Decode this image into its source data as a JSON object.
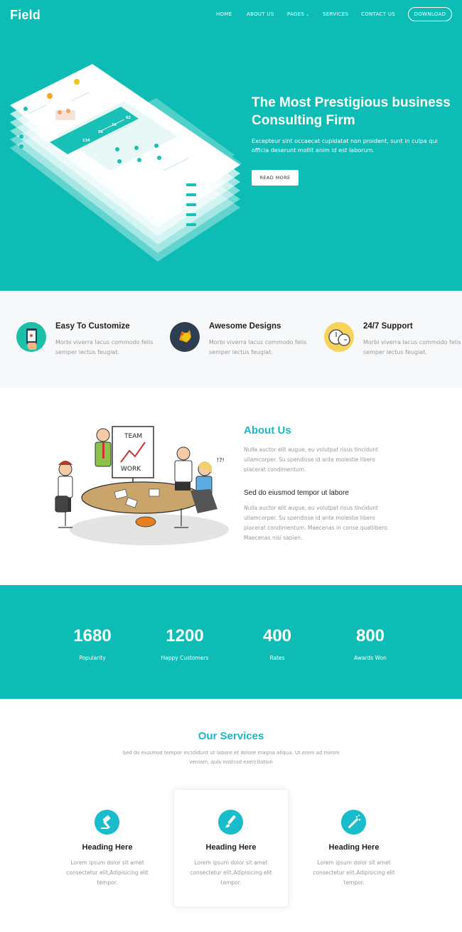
{
  "brand": {
    "name": "Field",
    "accent": "#0dbdb5",
    "heading_accent": "#18b8c6"
  },
  "nav": {
    "items": [
      "HOME",
      "ABOUT US",
      "PAGES",
      "SERVICES",
      "CONTACT US"
    ],
    "download": "DOWNLOAD"
  },
  "hero": {
    "title": "The Most Prestigious business Consulting Firm",
    "text": "Excepteur sint occaecat cupidatat non proident, sunt in culpa qui officia deserunt mollit anim id est laborum.",
    "button": "READ MORE",
    "mockup_stats": [
      "134",
      "56",
      "16",
      "62"
    ]
  },
  "features": [
    {
      "title": "Easy To Customize",
      "text": "Morbi viverra lacus commodo felis semper lectus feugiat.",
      "icon": "hand-tablet-icon"
    },
    {
      "title": "Awesome Designs",
      "text": "Morbi viverra lacus commodo felis semper lectus feugiat.",
      "icon": "idea-bulb-icon"
    },
    {
      "title": "24/7 Support",
      "text": "Morbi viverra lacus commodo felis semper lectus feugiat.",
      "icon": "clock-icon"
    }
  ],
  "about": {
    "title": "About Us",
    "p1": "Nulla auctor elit augue, eu volutpat risus tincidunt ullamcorper. Su spendisse id ante molestie libero placerat condimentum.",
    "subtitle": "Sed do eiusmod tempor ut labore",
    "p2": "Nulla auctor elit augue, eu volutpat risus tincidunt ullamcorper. Su spendisse id ante molestie libero placerat condimentum. Maecenas in conse quatlibero. Maecenas nisi sapien.",
    "illustration_text": [
      "TEAM",
      "WORK",
      "!?!"
    ]
  },
  "stats": [
    {
      "value": "1680",
      "label": "Popularity"
    },
    {
      "value": "1200",
      "label": "Happy Customers"
    },
    {
      "value": "400",
      "label": "Rates"
    },
    {
      "value": "800",
      "label": "Awards Won"
    }
  ],
  "services": {
    "title": "Our Services",
    "subtitle": "Sed do eiusmod tempor incididunt ut labore et dolore magna aliqua. Ut enim ad minim veniam, quis nostrud exercitation",
    "cards": [
      {
        "title": "Heading Here",
        "text": "Lorem ipsum dolor sit amet consectetur elit,Adipisicing elit tempor.",
        "icon": "gavel-icon"
      },
      {
        "title": "Heading Here",
        "text": "Lorem ipsum dolor sit amet consectetur elit,Adipisicing elit tempor.",
        "icon": "paint-brush-icon"
      },
      {
        "title": "Heading Here",
        "text": "Lorem ipsum dolor sit amet consectetur elit,Adipisicing elit tempor.",
        "icon": "magic-wand-icon"
      }
    ]
  }
}
